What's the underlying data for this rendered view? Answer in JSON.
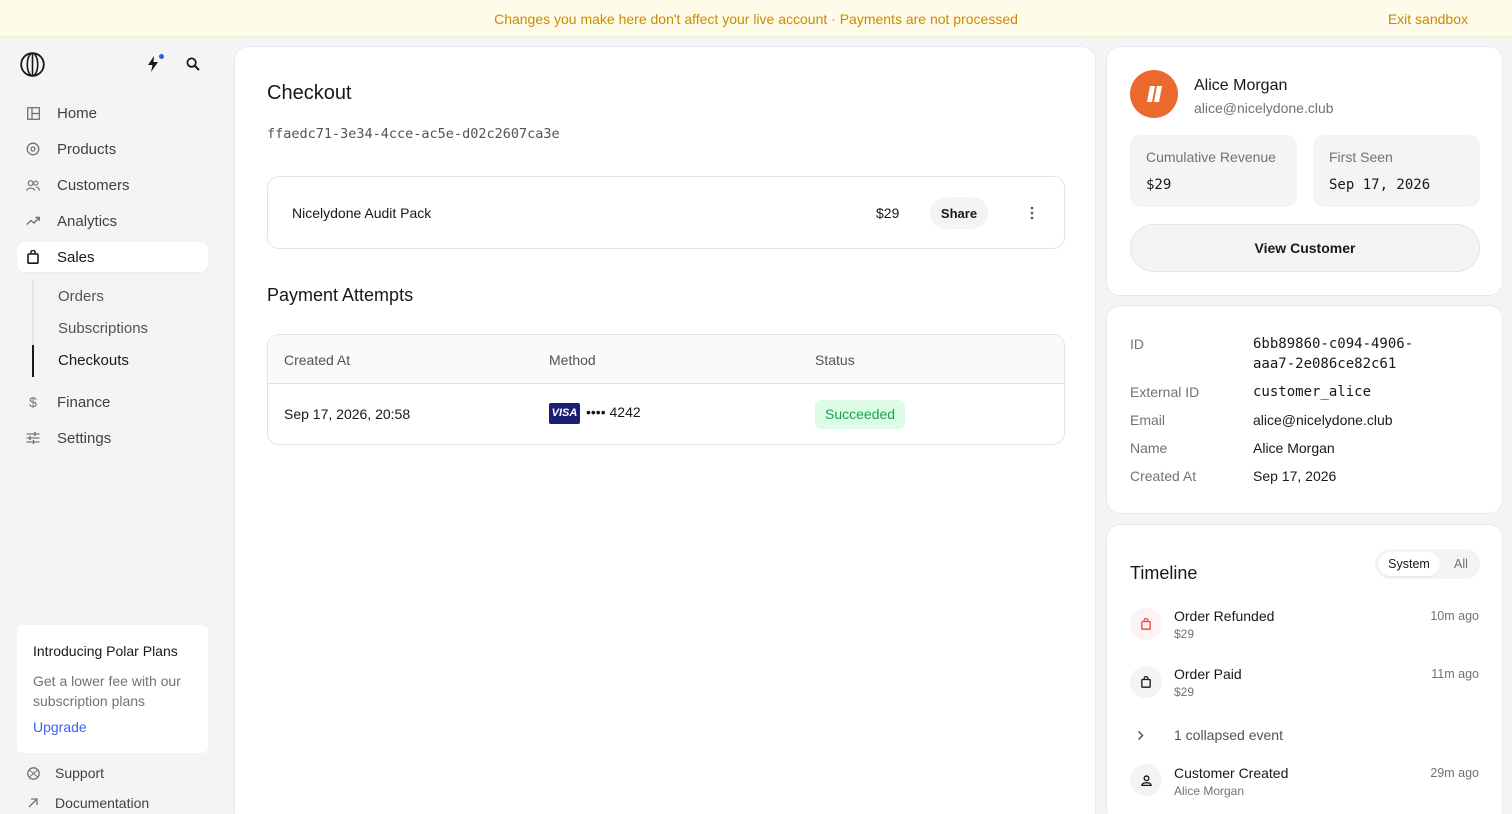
{
  "banner": {
    "message": "Changes you make here don't affect your live account · Payments are not processed",
    "exit_label": "Exit sandbox"
  },
  "sidebar": {
    "nav": [
      {
        "label": "Home",
        "icon": "home-icon"
      },
      {
        "label": "Products",
        "icon": "products-icon"
      },
      {
        "label": "Customers",
        "icon": "customers-icon"
      },
      {
        "label": "Analytics",
        "icon": "analytics-icon"
      },
      {
        "label": "Sales",
        "icon": "bag-icon",
        "active": true
      },
      {
        "label": "Finance",
        "icon": "dollar-icon"
      },
      {
        "label": "Settings",
        "icon": "settings-icon"
      }
    ],
    "sales_sub": [
      {
        "label": "Orders"
      },
      {
        "label": "Subscriptions"
      },
      {
        "label": "Checkouts",
        "active": true
      }
    ],
    "promo": {
      "title": "Introducing Polar Plans",
      "body": "Get a lower fee with our subscription plans",
      "link": "Upgrade"
    },
    "footer": [
      {
        "label": "Support",
        "icon": "globe-icon"
      },
      {
        "label": "Documentation",
        "icon": "arrow-up-right-icon"
      }
    ]
  },
  "checkout": {
    "title": "Checkout",
    "id": "ffaedc71-3e34-4cce-ac5e-d02c2607ca3e",
    "product": {
      "name": "Nicelydone Audit Pack",
      "price": "$29",
      "share_label": "Share"
    },
    "payment_attempts": {
      "title": "Payment Attempts",
      "columns": [
        "Created At",
        "Method",
        "Status"
      ],
      "rows": [
        {
          "created_at": "Sep 17, 2026, 20:58",
          "card_brand": "VISA",
          "card_last4": "•••• 4242",
          "status": "Succeeded"
        }
      ]
    }
  },
  "customer": {
    "name": "Alice Morgan",
    "email": "alice@nicelydone.club",
    "cumulative_revenue_label": "Cumulative Revenue",
    "cumulative_revenue": "$29",
    "first_seen_label": "First Seen",
    "first_seen": "Sep 17, 2026",
    "view_label": "View Customer",
    "accent": "#ea6a2e"
  },
  "details": {
    "id_label": "ID",
    "id_line1": "6bb89860-c094-4906-",
    "id_line2": "aaa7-2e086ce82c61",
    "external_id_label": "External ID",
    "external_id": "customer_alice",
    "email_label": "Email",
    "email": "alice@nicelydone.club",
    "name_label": "Name",
    "name": "Alice Morgan",
    "created_at_label": "Created At",
    "created_at": "Sep 17, 2026"
  },
  "timeline": {
    "title": "Timeline",
    "filter_system": "System",
    "filter_all": "All",
    "events": [
      {
        "title": "Order Refunded",
        "sub": "$29",
        "time": "10m ago"
      },
      {
        "title": "Order Paid",
        "sub": "$29",
        "time": "11m ago"
      },
      {
        "title": "Customer Created",
        "sub": "Alice Morgan",
        "time": "29m ago"
      }
    ],
    "collapsed_label": "1 collapsed event"
  }
}
